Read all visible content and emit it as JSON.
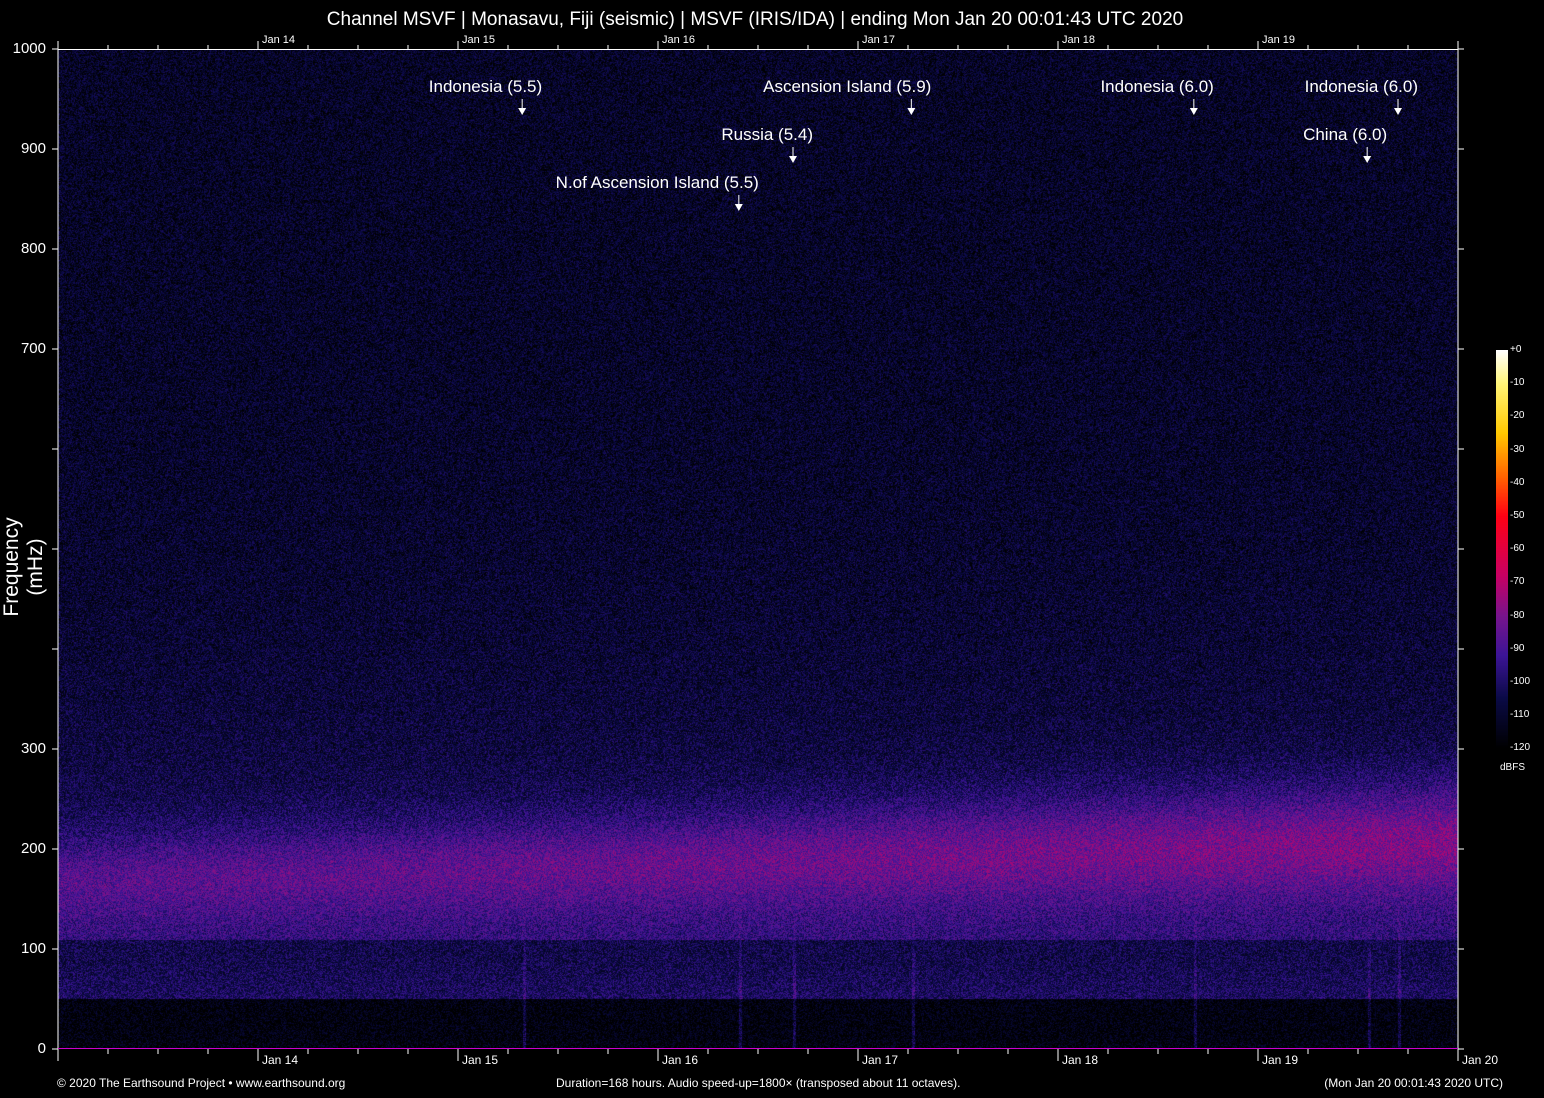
{
  "title": "Channel MSVF | Monasavu, Fiji (seismic) | MSVF (IRIS/IDA) | ending Mon Jan 20 00:01:43 UTC 2020",
  "chart_data": {
    "type": "heatmap",
    "title": "Channel MSVF | Monasavu, Fiji (seismic) | MSVF (IRIS/IDA) | ending Mon Jan 20 00:01:43 UTC 2020",
    "ylabel": "Frequency (mHz)",
    "ylim": [
      0,
      1000
    ],
    "y_ticks": [
      0,
      100,
      200,
      300,
      400,
      500,
      600,
      700,
      800,
      900,
      1000
    ],
    "y_tick_labels": [
      "0",
      "100",
      "200",
      "300",
      "",
      "",
      "",
      "700",
      "800",
      "900",
      "1000"
    ],
    "xlim_hours": [
      0,
      168
    ],
    "x_tick_labels_bottom": [
      "Jan 14",
      "Jan 15",
      "Jan 16",
      "Jan 17",
      "Jan 18",
      "Jan 19",
      "Jan 20"
    ],
    "x_tick_labels_top": [
      "Jan 14",
      "Jan 15",
      "Jan 16",
      "Jan 17",
      "Jan 18",
      "Jan 19"
    ],
    "colorbar": {
      "label": "dBFS",
      "ticks": [
        "+0",
        "-10",
        "-20",
        "-30",
        "-40",
        "-50",
        "-60",
        "-70",
        "-80",
        "-90",
        "-100",
        "-110",
        "-120"
      ],
      "range": [
        -120,
        0
      ]
    },
    "events": [
      {
        "label": "Indonesia (5.5)",
        "hour": 55.7
      },
      {
        "label": "Ascension Island (5.9)",
        "hour": 102.4
      },
      {
        "label": "Indonesia (6.0)",
        "hour": 136.3
      },
      {
        "label": "Indonesia (6.0)",
        "hour": 160.8
      },
      {
        "label": "Russia (5.4)",
        "hour": 88.2
      },
      {
        "label": "China (6.0)",
        "hour": 157.1
      },
      {
        "label": "N.of Ascension Island (5.5)",
        "hour": 81.7
      }
    ],
    "colors": {
      "low": "#000000",
      "mid": "#8a1a9a",
      "peak": "#e0004a",
      "high": "#ffffff"
    }
  },
  "footer": {
    "left": "© 2020 The Earthsound Project • www.earthsound.org",
    "center": "Duration=168 hours. Audio speed-up=1800× (transposed about 11 octaves).",
    "right": "(Mon Jan 20 00:01:43 2020 UTC)"
  }
}
